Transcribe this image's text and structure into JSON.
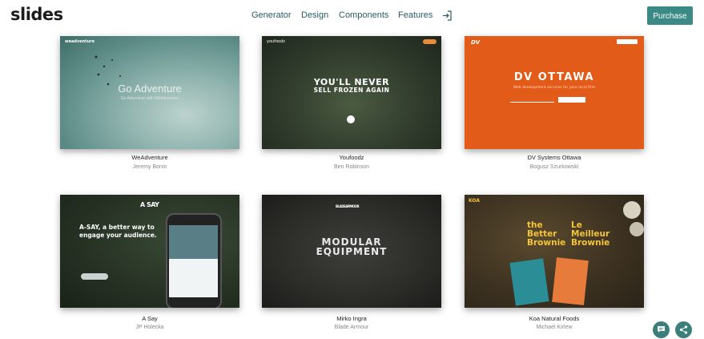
{
  "header": {
    "logo": "slides",
    "nav": [
      "Generator",
      "Design",
      "Components",
      "Features"
    ],
    "purchase_label": "Purchase"
  },
  "cards": [
    {
      "title": "WeAdventure",
      "author": "Jeremy Bonin",
      "thumb": {
        "brand": "weadventure",
        "hero": "Go Adventure",
        "sub": "Go Adventure with WeAdventure"
      }
    },
    {
      "title": "Youfoodz",
      "author": "Ben Robinson",
      "thumb": {
        "brand": "youfoodz",
        "hero1": "YOU'LL NEVER",
        "hero2": "SELL FROZEN AGAIN"
      }
    },
    {
      "title": "DV Systems Ottawa",
      "author": "Bogusz Szurkowski",
      "thumb": {
        "logo": "DV",
        "hero": "DV OTTAWA",
        "sub": "Web development services for your local firm"
      }
    },
    {
      "title": "A Say",
      "author": "JP Holecka",
      "thumb": {
        "logo": "A SAY",
        "hero": "A-SAY, a better way to engage your audience."
      }
    },
    {
      "title": "Mirko Ingra",
      "author": "Blade Armour",
      "thumb": {
        "logo": "BLADEARMOUR",
        "hero1": "MODULAR",
        "hero2": "EQUIPMENT"
      }
    },
    {
      "title": "Koa Natural Foods",
      "author": "Michael Kirlew",
      "thumb": {
        "logo": "KOA",
        "b1": "the Better Brownie",
        "b2": "Le Meilleur Brownie"
      }
    }
  ],
  "icons": {
    "signin": "sign-in-icon",
    "chat": "chat-icon",
    "share": "share-icon"
  },
  "colors": {
    "accent": "#3b8a86",
    "nav_text": "#2a5c60"
  }
}
